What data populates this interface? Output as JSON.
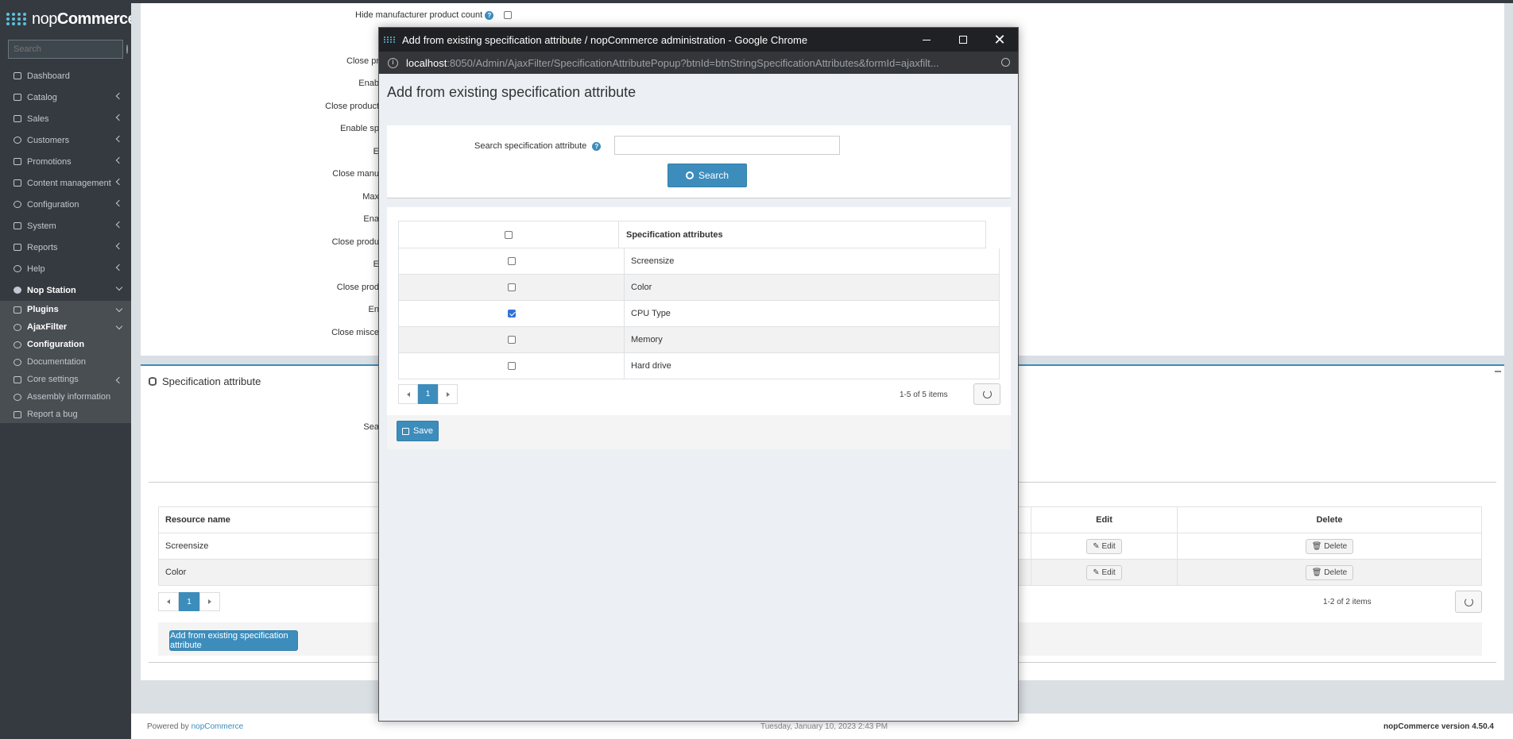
{
  "sidebar": {
    "logo": "nopCommerce",
    "search_placeholder": "Search",
    "items": [
      {
        "label": "Dashboard"
      },
      {
        "label": "Catalog"
      },
      {
        "label": "Sales"
      },
      {
        "label": "Customers"
      },
      {
        "label": "Promotions"
      },
      {
        "label": "Content management"
      },
      {
        "label": "Configuration"
      },
      {
        "label": "System"
      },
      {
        "label": "Reports"
      },
      {
        "label": "Help"
      },
      {
        "label": "Nop Station"
      }
    ],
    "sub": {
      "plugins": "Plugins",
      "ajaxfilter": "AjaxFilter",
      "configuration": "Configuration",
      "documentation": "Documentation",
      "core_settings": "Core settings",
      "assembly": "Assembly information",
      "report_bug": "Report a bug"
    }
  },
  "settings": {
    "hide_manufacturer": "Hide manufacturer product count",
    "rows": [
      "Close pr",
      "Enab",
      "Close product",
      "Enable sp",
      "E",
      "Close manu",
      "Max",
      "Ena",
      "Close produ",
      "E",
      "Close prod",
      "En",
      "Close misce"
    ]
  },
  "spec_section": {
    "title": "Specification attribute",
    "search_stub": "Sea",
    "columns": {
      "resource": "Resource name",
      "edit": "Edit",
      "delete": "Delete"
    },
    "rows": [
      {
        "name": "Screensize",
        "edit": "Edit",
        "delete": "Delete"
      },
      {
        "name": "Color",
        "edit": "Edit",
        "delete": "Delete"
      }
    ],
    "page": "1",
    "count": "1-2 of 2 items",
    "add_button": "Add from existing specification attribute"
  },
  "footer": {
    "powered_prefix": "Powered by ",
    "powered_link": "nopCommerce",
    "date": "Tuesday, January 10, 2023 2:43 PM",
    "version": "nopCommerce version 4.50.4"
  },
  "popup": {
    "window_title": "Add from existing specification attribute / nopCommerce administration - Google Chrome",
    "url_host": "localhost",
    "url_rest": ":8050/Admin/AjaxFilter/SpecificationAttributePopup?btnId=btnStringSpecificationAttributes&formId=ajaxfilt...",
    "heading": "Add from existing specification attribute",
    "search_label": "Search specification attribute",
    "search_value": "",
    "search_button": "Search",
    "column_header": "Specification attributes",
    "attributes": [
      {
        "name": "Screensize",
        "checked": false
      },
      {
        "name": "Color",
        "checked": false
      },
      {
        "name": "CPU Type",
        "checked": true
      },
      {
        "name": "Memory",
        "checked": false
      },
      {
        "name": "Hard drive",
        "checked": false
      }
    ],
    "page": "1",
    "count": "1-5 of 5 items",
    "save_button": "Save"
  }
}
